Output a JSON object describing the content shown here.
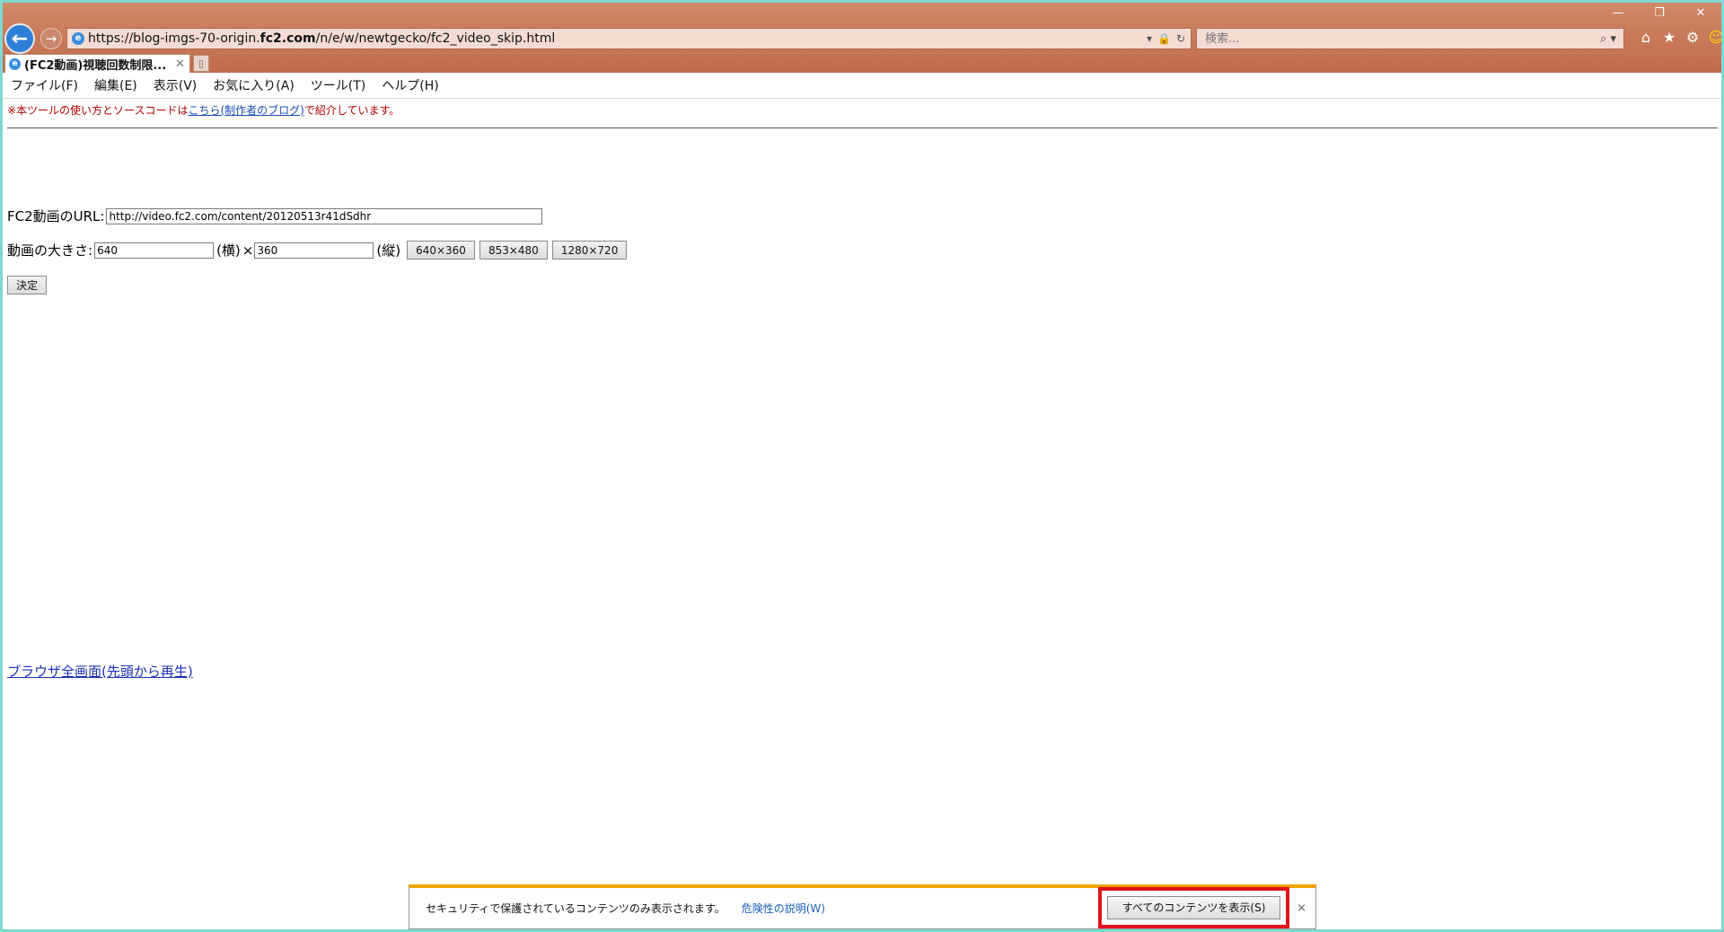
{
  "window": {
    "minimize": "—",
    "restore": "❐",
    "close": "✕"
  },
  "nav": {
    "back_icon": "←",
    "forward_icon": "→"
  },
  "address": {
    "url_prefix": "https://blog-imgs-70-origin.",
    "url_domain": "fc2.com",
    "url_path": "/n/e/w/newtgecko/fc2_video_skip.html",
    "dropdown_icon": "▾",
    "lock_icon": "🔒",
    "refresh_icon": "↻"
  },
  "search": {
    "placeholder": "検索...",
    "icon": "⌕ ▾"
  },
  "toolbar_icons": {
    "home": "⌂",
    "favorites": "★",
    "settings": "⚙",
    "smiley": "☺"
  },
  "tab": {
    "title": "(FC2動画)視聴回数制限...",
    "close": "✕",
    "new_tab": "▯"
  },
  "menu": {
    "items": [
      "ファイル(F)",
      "編集(E)",
      "表示(V)",
      "お気に入り(A)",
      "ツール(T)",
      "ヘルプ(H)"
    ]
  },
  "page": {
    "notice_prefix": "※本ツールの使い方とソースコードは",
    "notice_link": "こちら(制作者のブログ)",
    "notice_suffix": "で紹介しています。",
    "url_label": "FC2動画のURL:",
    "url_value": "http://video.fc2.com/content/20120513r41dSdhr",
    "size_label": "動画の大きさ:",
    "width_value": "640",
    "width_suffix": "(横)",
    "times": "×",
    "height_value": "360",
    "height_suffix": "(縦)",
    "preset1": "640×360",
    "preset2": "853×480",
    "preset3": "1280×720",
    "decide": "決定",
    "fullscreen_link": "ブラウザ全画面(先頭から再生)"
  },
  "notification": {
    "message": "セキュリティで保護されているコンテンツのみ表示されます。",
    "info_link": "危険性の説明(W)",
    "show_all": "すべてのコンテンツを表示(S)",
    "close": "×"
  }
}
